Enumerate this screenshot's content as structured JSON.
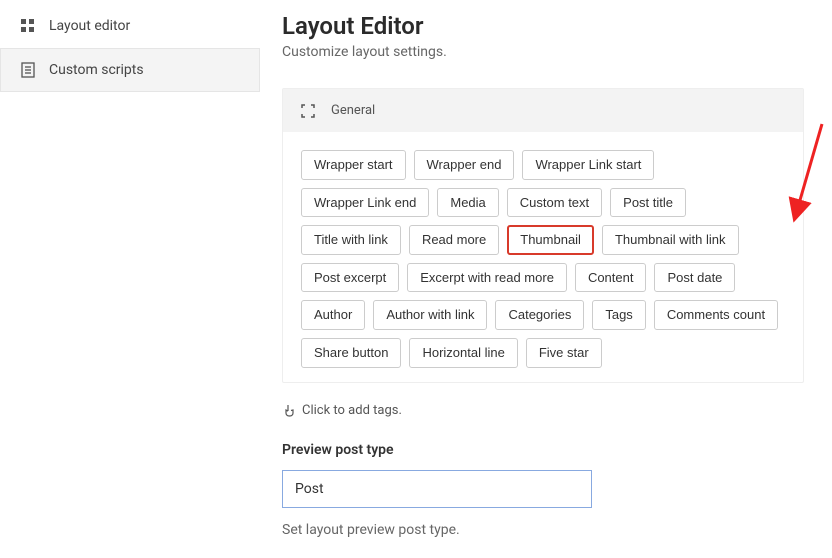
{
  "sidebar": {
    "items": [
      {
        "label": "Layout editor",
        "icon": "grid-icon"
      },
      {
        "label": "Custom scripts",
        "icon": "clipboard-icon"
      }
    ],
    "activeIndex": 1
  },
  "page": {
    "title": "Layout Editor",
    "subtitle": "Customize layout settings."
  },
  "panel": {
    "header_label": "General",
    "tags": [
      "Wrapper start",
      "Wrapper end",
      "Wrapper Link start",
      "Wrapper Link end",
      "Media",
      "Custom text",
      "Post title",
      "Title with link",
      "Read more",
      "Thumbnail",
      "Thumbnail with link",
      "Post excerpt",
      "Excerpt with read more",
      "Content",
      "Post date",
      "Author",
      "Author with link",
      "Categories",
      "Tags",
      "Comments count",
      "Share button",
      "Horizontal line",
      "Five star"
    ],
    "highlighted_tag": "Thumbnail"
  },
  "hint": {
    "text": "Click to add tags."
  },
  "preview": {
    "label": "Preview post type",
    "value": "Post",
    "description": "Set layout preview post type."
  }
}
